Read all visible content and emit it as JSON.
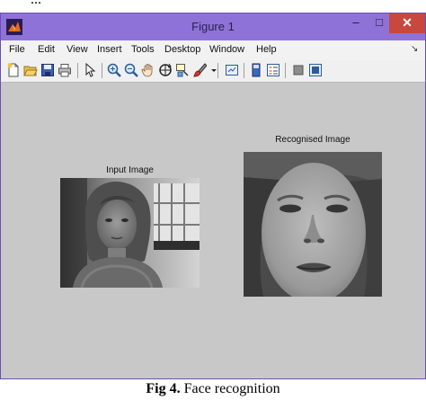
{
  "window": {
    "title": "Figure 1"
  },
  "window_buttons": {
    "minimize": "–",
    "maximize": "□",
    "close": "✕"
  },
  "menu": [
    "File",
    "Edit",
    "View",
    "Insert",
    "Tools",
    "Desktop",
    "Window",
    "Help"
  ],
  "menu_overflow": "↘",
  "toolbar_icons": [
    "new-figure-icon",
    "open-file-icon",
    "save-icon",
    "print-icon",
    "pointer-icon",
    "zoom-in-icon",
    "zoom-out-icon",
    "pan-icon",
    "rotate-3d-icon",
    "data-cursor-icon",
    "brush-icon",
    "brush-dropdown-icon",
    "link-plot-icon",
    "colorbar-icon",
    "legend-icon",
    "hide-plot-tools-icon",
    "show-plot-tools-icon"
  ],
  "figure": {
    "left_axes_title": "Input Image",
    "right_axes_title": "Recognised Image"
  },
  "caption": {
    "label": "Fig 4.",
    "text": " Face recognition"
  }
}
